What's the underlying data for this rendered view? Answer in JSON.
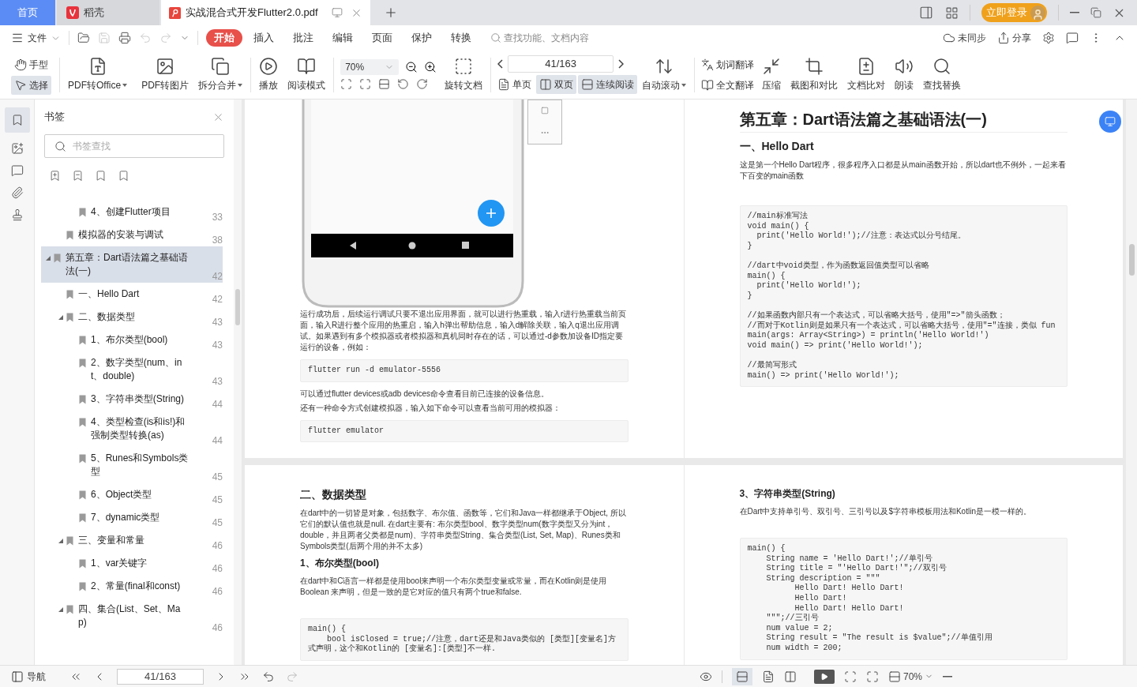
{
  "tabs": [
    {
      "label": "首页",
      "kind": "home",
      "selected": false
    },
    {
      "label": "稻壳",
      "kind": "app",
      "selected": false
    },
    {
      "label": "实战混合式开发Flutter2.0.pdf",
      "kind": "doc",
      "selected": true
    }
  ],
  "login_button": "立即登录",
  "menu": {
    "file": "文件",
    "tabs": [
      {
        "label": "开始",
        "selected": true
      },
      {
        "label": "插入",
        "selected": false
      },
      {
        "label": "批注",
        "selected": false
      },
      {
        "label": "编辑",
        "selected": false
      },
      {
        "label": "页面",
        "selected": false
      },
      {
        "label": "保护",
        "selected": false
      },
      {
        "label": "转换",
        "selected": false
      }
    ],
    "search_placeholder": "查找功能、文档内容",
    "sync": "未同步",
    "share": "分享"
  },
  "toolbar": {
    "hand": {
      "label": "手型",
      "selected": false
    },
    "select": {
      "label": "选择",
      "selected": true
    },
    "pdf_to_office": "PDF转Office",
    "pdf_to_image": "PDF转图片",
    "split_merge": "拆分合并",
    "play": "播放",
    "read_mode": "阅读模式",
    "zoom": "70%",
    "rotate": "旋转文档",
    "page_input": "41/163",
    "single_page": {
      "label": "单页",
      "selected": false
    },
    "double_page": {
      "label": "双页",
      "selected": true
    },
    "continuous": {
      "label": "连续阅读",
      "selected": true
    },
    "auto_scroll": "自动滚动",
    "word_translate": "划词翻译",
    "full_translate": "全文翻译",
    "compress": "压缩",
    "screenshot_compare": "截图和对比",
    "doc_compare": "文档比对",
    "read_aloud": "朗读",
    "find_replace": "查找替换"
  },
  "sidebar": {
    "title": "书签",
    "search_placeholder": "书签查找",
    "tree": [
      {
        "children": [
          {
            "children": [
              {
                "label": "4、创建Flutter项目",
                "page": "33",
                "selected": false
              }
            ]
          },
          {
            "label": "模拟器的安装与调试",
            "page": "38",
            "selected": false
          }
        ]
      },
      {
        "label": "第五章：Dart语法篇之基础语法(一)",
        "page": "42",
        "expanded": true,
        "selected": true,
        "children": [
          {
            "label": "一、Hello Dart",
            "page": "42",
            "selected": false
          },
          {
            "label": "二、数据类型",
            "page": "43",
            "expanded": true,
            "selected": false,
            "children": [
              {
                "label": "1、布尔类型(bool)",
                "page": "43",
                "selected": false
              },
              {
                "label": "2、数字类型(num、int、double)",
                "page": "43",
                "selected": false
              },
              {
                "label": "3、字符串类型(String)",
                "page": "44",
                "selected": false
              },
              {
                "label": "4、类型检查(is和is!)和强制类型转换(as)",
                "page": "44",
                "selected": false
              },
              {
                "label": "5、Runes和Symbols类型",
                "page": "45",
                "selected": false
              },
              {
                "label": "6、Object类型",
                "page": "45",
                "selected": false
              },
              {
                "label": "7、dynamic类型",
                "page": "45",
                "selected": false
              }
            ]
          },
          {
            "label": "三、变量和常量",
            "page": "46",
            "expanded": true,
            "selected": false,
            "children": [
              {
                "label": "1、var关键字",
                "page": "46",
                "selected": false
              },
              {
                "label": "2、常量(final和const)",
                "page": "46",
                "selected": false
              }
            ]
          },
          {
            "label": "四、集合(List、Set、Map)",
            "page": "46",
            "expanded": true,
            "selected": false
          }
        ]
      }
    ]
  },
  "top_spread": {
    "left_page": {
      "blocks": [
        {
          "kind": "phone"
        },
        {
          "kind": "p",
          "text": "运行成功后，后续运行调试只要不退出应用界面，就可以进行热重载，输入r进行热重载当前页面，输入R进行整个应用的热重启，输入h弹出帮助信息，输入d解除关联，输入q退出应用调试。如果遇到有多个模拟器或者模拟器和真机同时存在的话，可以通过-d参数加设备ID指定要运行的设备，例如："
        },
        {
          "kind": "code",
          "groups": [
            [
              "flutter run -d emulator-5556"
            ]
          ]
        },
        {
          "kind": "p",
          "text": "可以通过flutter devices或adb devices命令查看目前已连接的设备信息。"
        },
        {
          "kind": "p",
          "text": "还有一种命令方式创建模拟器，输入如下命令可以查看当前可用的模拟器："
        },
        {
          "kind": "code",
          "groups": [
            [
              "flutter emulator"
            ]
          ]
        }
      ]
    },
    "right_page": {
      "blocks": [
        {
          "kind": "h1",
          "text": "第五章：Dart语法篇之基础语法(一)"
        },
        {
          "kind": "h2",
          "text": "一、Hello Dart"
        },
        {
          "kind": "p",
          "text": "这是第一个Hello Dart程序，很多程序入口都是从main函数开始，所以dart也不例外，一起来看下百变的main函数"
        },
        {
          "kind": "code",
          "groups": [
            [
              "//main标准写法",
              "void main() {",
              "  print('Hello World!');//注意：表达式以分号结尾。",
              "}"
            ],
            [
              "//dart中void类型，作为函数返回值类型可以省略",
              "main() {",
              "  print('Hello World!');",
              "}"
            ],
            [
              "//如果函数内部只有一个表达式，可以省略大括号，使用\"=>\"箭头函数；",
              "//而对于Kotlin则是如果只有一个表达式，可以省略大括号，使用\"=\"连接，类似 fun main(args: Array<String>) = println('Hello World!')",
              "void main() => print('Hello World!');"
            ],
            [
              "//最简写形式",
              "main() => print('Hello World!');"
            ]
          ]
        }
      ]
    }
  },
  "bottom_spread": {
    "left_page": {
      "blocks": [
        {
          "kind": "h2",
          "text": "二、数据类型"
        },
        {
          "kind": "p",
          "text": "在dart中的一切皆是对象，包括数字、布尔值、函数等，它们和Java一样都继承于Object, 所以它们的默认值也就是null. 在dart主要有: 布尔类型bool、数字类型num(数字类型又分为int，double，并且两者父类都是num)、字符串类型String、集合类型(List, Set, Map)、Runes类和Symbols类型(后两个用的并不太多)"
        },
        {
          "kind": "h3",
          "text": "1、布尔类型(bool)"
        },
        {
          "kind": "p",
          "text": "在dart中和C语言一样都是使用bool来声明一个布尔类型变量或常量，而在Kotlin则是使用Boolean 来声明，但是一致的是它对应的值只有两个true和false."
        },
        {
          "kind": "code",
          "groups": [
            [
              "main() {",
              "    bool isClosed = true;//注意，dart还是和Java类似的 [类型][变量名]方式声明，这个和Kotlin的 [变量名]:[类型]不一样."
            ]
          ]
        }
      ]
    },
    "right_page": {
      "blocks": [
        {
          "kind": "h3",
          "text": "3、字符串类型(String)"
        },
        {
          "kind": "p",
          "text": "在Dart中支持单引号、双引号、三引号以及$字符串模板用法和Kotlin是一模一样的。"
        },
        {
          "kind": "code",
          "groups": [
            [
              "main() {",
              "    String name = 'Hello Dart!';//单引号",
              "    String title = \"'Hello Dart!'\";//双引号",
              "    String description = \"\"\"",
              "          Hello Dart! Hello Dart!",
              "          Hello Dart!",
              "          Hello Dart! Hello Dart!",
              "    \"\"\";//三引号",
              "    num value = 2;",
              "    String result = \"The result is $value\";//单值引用",
              "    num width = 200;"
            ]
          ]
        }
      ]
    }
  },
  "status": {
    "nav": "导航",
    "page": "41/163",
    "zoom": "70%"
  }
}
